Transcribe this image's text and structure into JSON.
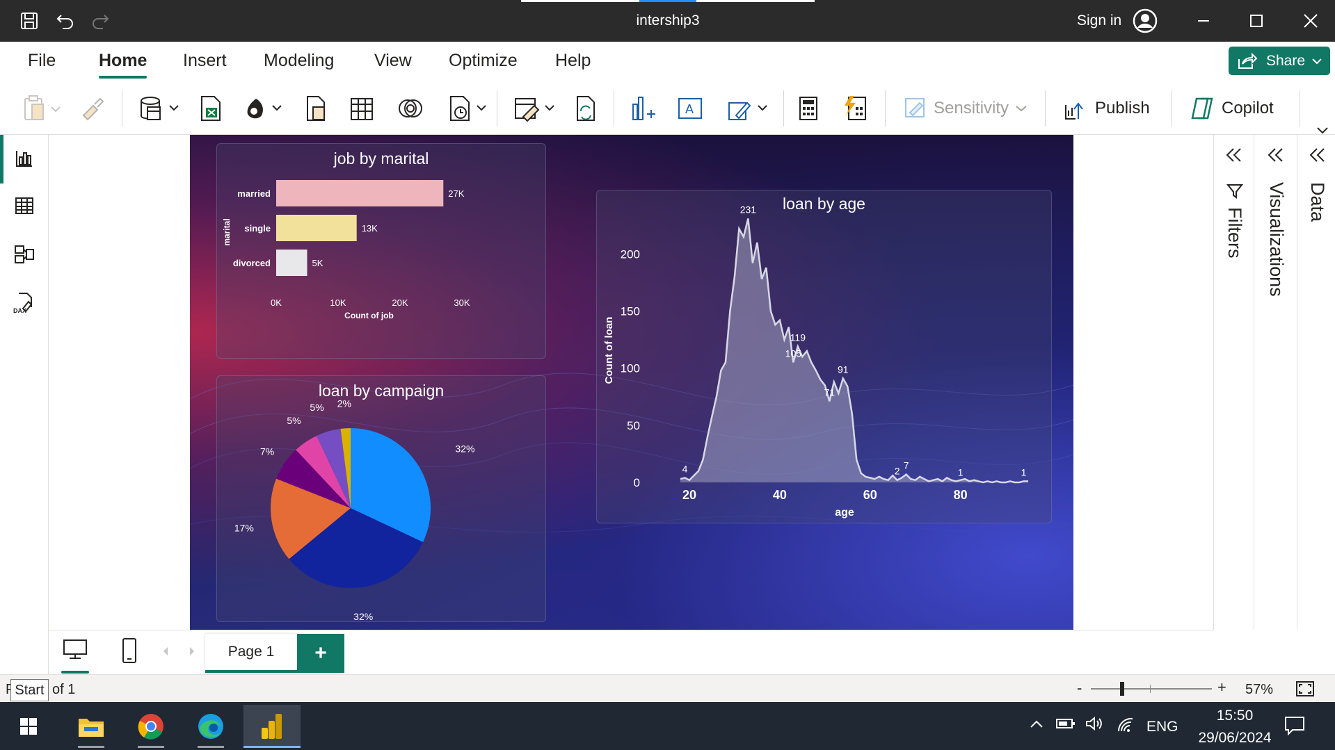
{
  "window": {
    "title": "intership3",
    "sign_in": "Sign in"
  },
  "menu": {
    "tabs": [
      "File",
      "Home",
      "Insert",
      "Modeling",
      "View",
      "Optimize",
      "Help"
    ],
    "active_tab": "Home",
    "share_label": "Share"
  },
  "ribbon": {
    "sensitivity_label": "Sensitivity",
    "publish_label": "Publish",
    "copilot_label": "Copilot"
  },
  "panes": {
    "filters": "Filters",
    "visualizations": "Visualizations",
    "data": "Data"
  },
  "report": {
    "visuals": [
      {
        "title": "job by marital"
      },
      {
        "title": "loan by campaign"
      },
      {
        "title": "loan by age"
      }
    ]
  },
  "chart_data": [
    {
      "type": "bar",
      "orientation": "horizontal",
      "title": "job by marital",
      "xlabel": "Count of job",
      "ylabel": "marital",
      "categories": [
        "married",
        "single",
        "divorced"
      ],
      "values": [
        27000,
        13000,
        5000
      ],
      "data_labels": [
        "27K",
        "13K",
        "5K"
      ],
      "colors": [
        "#eeb5bc",
        "#f2e19a",
        "#e8e8ea"
      ],
      "xlim": [
        0,
        30000
      ],
      "x_ticks": [
        "0K",
        "10K",
        "20K",
        "30K"
      ]
    },
    {
      "type": "pie",
      "title": "loan by campaign",
      "slices": [
        {
          "label": "32%",
          "value": 32,
          "color": "#118dff"
        },
        {
          "label": "32%",
          "value": 32,
          "color": "#12239e"
        },
        {
          "label": "17%",
          "value": 17,
          "color": "#e66c37"
        },
        {
          "label": "7%",
          "value": 7,
          "color": "#6b007b"
        },
        {
          "label": "5%",
          "value": 5,
          "color": "#e044a7"
        },
        {
          "label": "5%",
          "value": 5,
          "color": "#744ec2"
        },
        {
          "label": "2%",
          "value": 2,
          "color": "#d9b300"
        }
      ]
    },
    {
      "type": "area",
      "title": "loan by age",
      "xlabel": "age",
      "ylabel": "Count of loan",
      "xlim": [
        18,
        95
      ],
      "ylim": [
        0,
        230
      ],
      "x_ticks": [
        "20",
        "40",
        "60",
        "80"
      ],
      "y_ticks": [
        "0",
        "50",
        "100",
        "150",
        "200"
      ],
      "x": [
        18,
        19,
        20,
        21,
        22,
        23,
        24,
        25,
        26,
        27,
        28,
        29,
        30,
        31,
        32,
        33,
        34,
        35,
        36,
        37,
        38,
        39,
        40,
        41,
        42,
        43,
        44,
        45,
        46,
        47,
        48,
        49,
        50,
        51,
        52,
        53,
        54,
        55,
        56,
        57,
        58,
        59,
        60,
        61,
        62,
        63,
        64,
        65,
        66,
        67,
        68,
        69,
        70,
        71,
        72,
        73,
        74,
        75,
        76,
        77,
        78,
        79,
        80,
        81,
        82,
        83,
        84,
        85,
        86,
        87,
        88,
        89,
        90,
        91,
        92,
        93,
        94,
        95
      ],
      "y": [
        3,
        4,
        2,
        6,
        10,
        20,
        40,
        58,
        75,
        98,
        105,
        150,
        180,
        222,
        215,
        231,
        192,
        210,
        178,
        188,
        150,
        138,
        142,
        125,
        136,
        105,
        119,
        110,
        115,
        105,
        98,
        90,
        85,
        71,
        88,
        78,
        91,
        84,
        60,
        20,
        8,
        5,
        4,
        3,
        5,
        3,
        2,
        6,
        2,
        4,
        7,
        3,
        2,
        5,
        3,
        1,
        2,
        3,
        1,
        4,
        2,
        1,
        2,
        3,
        1,
        2,
        1,
        0,
        1,
        0,
        1,
        0,
        0,
        1,
        0,
        0,
        1,
        1
      ],
      "data_labels": [
        {
          "x": 19,
          "y": 4,
          "text": "4"
        },
        {
          "x": 33,
          "y": 231,
          "text": "231"
        },
        {
          "x": 43,
          "y": 105,
          "text": "105"
        },
        {
          "x": 44,
          "y": 119,
          "text": "119"
        },
        {
          "x": 51,
          "y": 71,
          "text": "71"
        },
        {
          "x": 54,
          "y": 91,
          "text": "91"
        },
        {
          "x": 66,
          "y": 2,
          "text": "2"
        },
        {
          "x": 68,
          "y": 7,
          "text": "7"
        },
        {
          "x": 80,
          "y": 1,
          "text": "1"
        },
        {
          "x": 94,
          "y": 1,
          "text": "1"
        }
      ]
    }
  ],
  "pages": {
    "current": "Page 1",
    "add_label": "+"
  },
  "status": {
    "page_info": "of 1",
    "page_prefix": "P",
    "zoom": "57%",
    "zoom_minus": "-",
    "zoom_plus": "+",
    "tooltip": "Start"
  },
  "taskbar": {
    "language": "ENG",
    "time": "15:50",
    "date": "29/06/2024"
  }
}
